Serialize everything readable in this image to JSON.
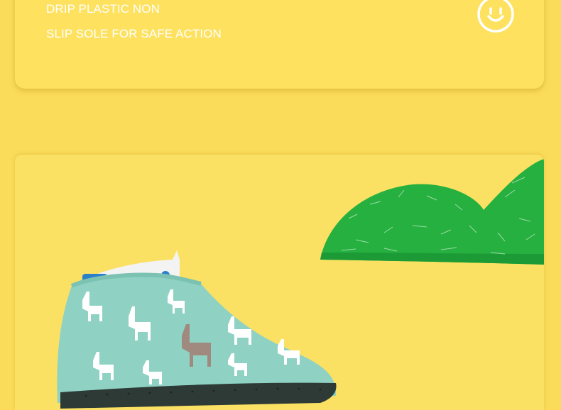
{
  "feature_card": {
    "lines": [
      "DRIP PLASTIC NON",
      "SLIP SOLE FOR SAFE ACTION"
    ],
    "icon": "smiley-face-icon"
  },
  "product_photo": {
    "shoe_cover_print": "alpaca-pattern",
    "cover_color": "#8fd2c4",
    "green_cover_color": "#25b040"
  }
}
